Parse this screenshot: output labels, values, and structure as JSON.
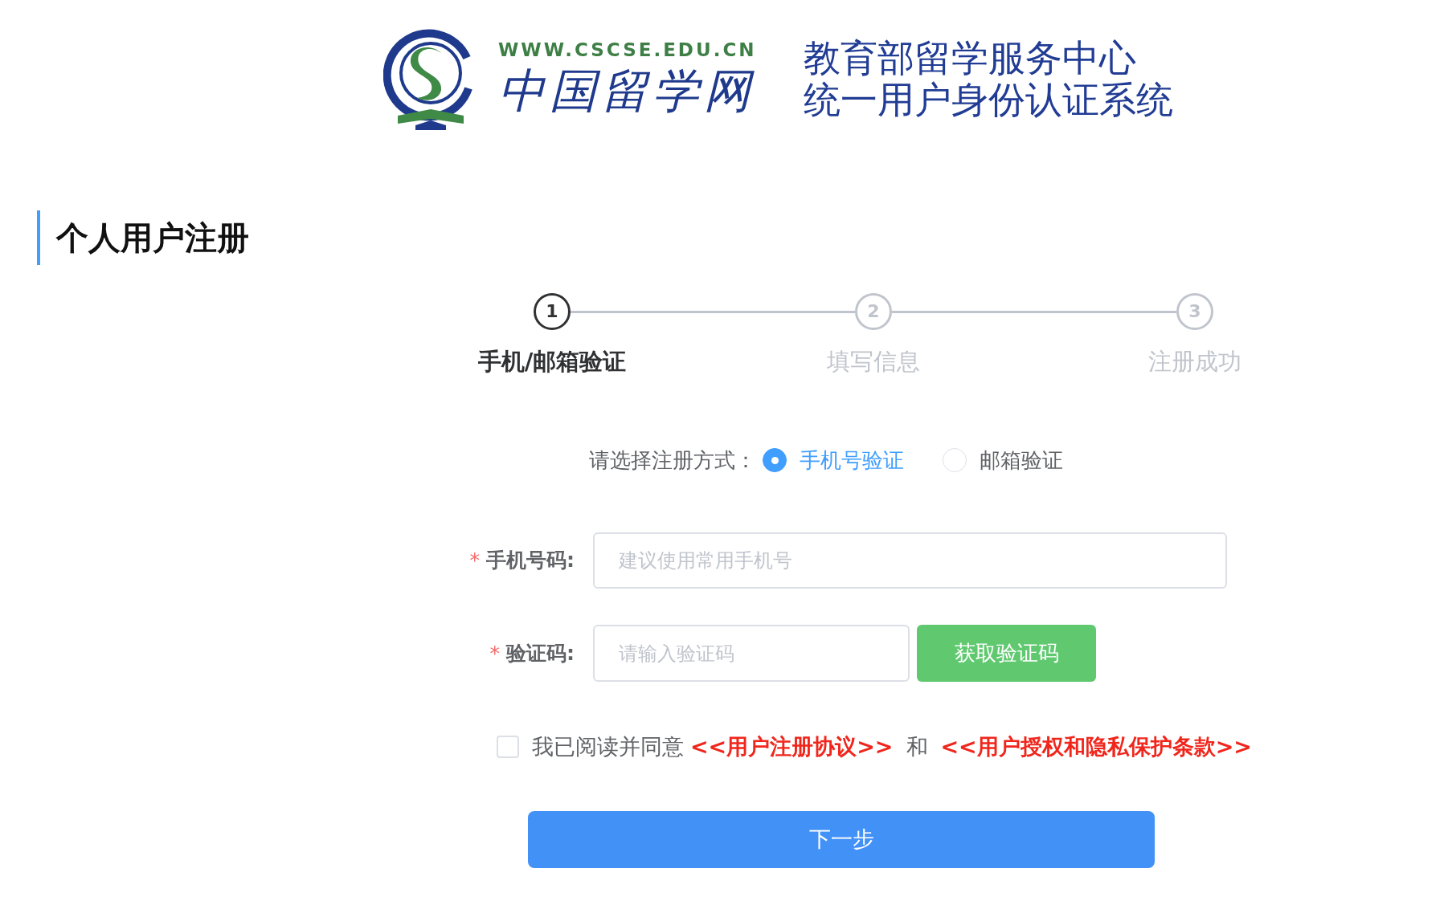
{
  "header": {
    "site_url": "WWW.CSCSE.EDU.CN",
    "site_name": "中国留学网",
    "system_title_lines": [
      "教育部留学服务中心",
      "统一用户身份认证系统"
    ]
  },
  "page_title": "个人用户注册",
  "steps": [
    {
      "number": "1",
      "label": "手机/邮箱验证",
      "active": true
    },
    {
      "number": "2",
      "label": "填写信息",
      "active": false
    },
    {
      "number": "3",
      "label": "注册成功",
      "active": false
    }
  ],
  "registration_method": {
    "label": "请选择注册方式：",
    "options": [
      {
        "label": "手机号验证",
        "selected": true
      },
      {
        "label": "邮箱验证",
        "selected": false
      }
    ]
  },
  "fields": [
    {
      "required_mark": "*",
      "label": "手机号码:",
      "placeholder": "建议使用常用手机号"
    },
    {
      "required_mark": "*",
      "label": "验证码:",
      "placeholder": "请输入验证码",
      "button": "获取验证码"
    }
  ],
  "agreement": {
    "checked": false,
    "text": "我已阅读并同意",
    "links": [
      "<<用户注册协议>>",
      "<<用户授权和隐私保护条款>>"
    ],
    "conjunction": "和"
  },
  "next_button": "下一步"
}
